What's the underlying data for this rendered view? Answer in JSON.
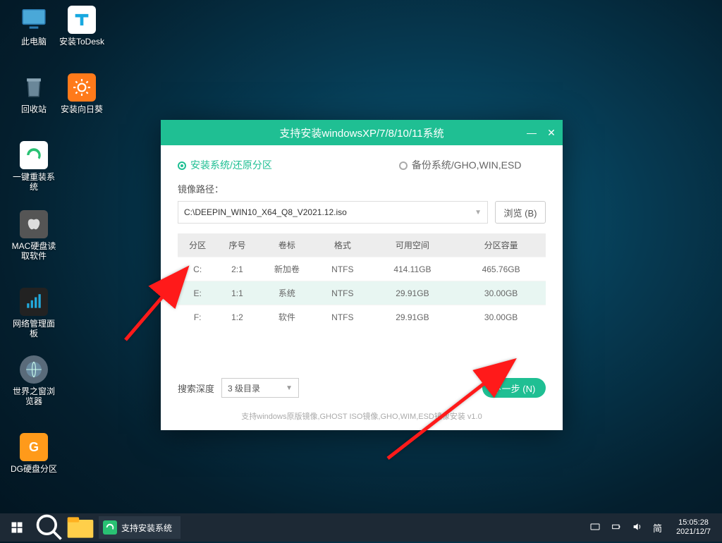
{
  "desktop_icons": [
    {
      "label": "此电脑",
      "bg": "transparent"
    },
    {
      "label": "安装ToDesk",
      "bg": "#fff"
    },
    {
      "label": "回收站",
      "bg": "transparent"
    },
    {
      "label": "安装向日葵",
      "bg": "#ff7a1a"
    },
    {
      "label": "一键重装系统",
      "bg": "#fff"
    },
    {
      "label": "MAC硬盘读取软件",
      "bg": "#555"
    },
    {
      "label": "网络管理面板",
      "bg": "#222"
    },
    {
      "label": "世界之窗浏览器",
      "bg": "#5a6b7a"
    },
    {
      "label": "DG硬盘分区",
      "bg": "#ff9a1a"
    }
  ],
  "window": {
    "title": "支持安装windowsXP/7/8/10/11系统",
    "tab_install": "安装系统/还原分区",
    "tab_backup": "备份系统/GHO,WIN,ESD",
    "image_path_label": "镜像路径：",
    "image_path": "C:\\DEEPIN_WIN10_X64_Q8_V2021.12.iso",
    "browse": "浏览 (B)",
    "headers": {
      "part": "分区",
      "seq": "序号",
      "vol": "卷标",
      "fmt": "格式",
      "free": "可用空间",
      "size": "分区容量"
    },
    "rows": [
      {
        "part": "C:",
        "seq": "2:1",
        "vol": "新加卷",
        "fmt": "NTFS",
        "free": "414.11GB",
        "size": "465.76GB"
      },
      {
        "part": "E:",
        "seq": "1:1",
        "vol": "系统",
        "fmt": "NTFS",
        "free": "29.91GB",
        "size": "30.00GB"
      },
      {
        "part": "F:",
        "seq": "1:2",
        "vol": "软件",
        "fmt": "NTFS",
        "free": "29.91GB",
        "size": "30.00GB"
      }
    ],
    "depth_label": "搜索深度",
    "depth_value": "3 级目录",
    "next": "下一步 (N)",
    "footnote": "支持windows原版镜像,GHOST ISO镜像,GHO,WIM,ESD镜像安装  v1.0"
  },
  "taskbar": {
    "app": "支持安装系统",
    "ime": "简",
    "time": "15:05:28",
    "date": "2021/12/7"
  }
}
